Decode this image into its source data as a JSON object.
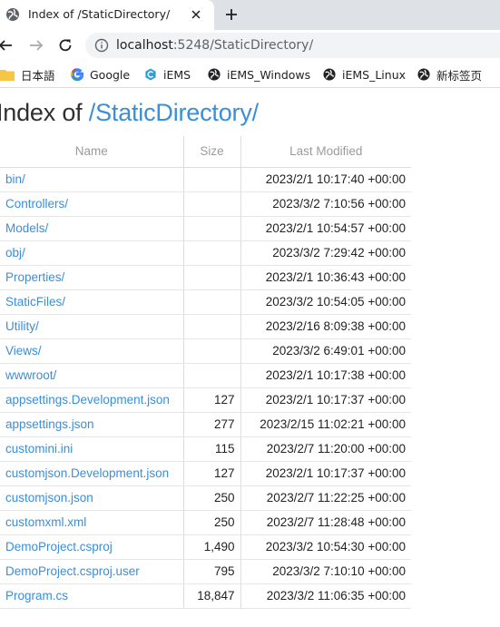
{
  "tab": {
    "title": "Index of /StaticDirectory/"
  },
  "address_bar": {
    "host": "localhost",
    "path": ":5248/StaticDirectory/"
  },
  "bookmarks": [
    {
      "label": "日本語",
      "icon": "folder-icon"
    },
    {
      "label": "Google",
      "icon": "google-icon"
    },
    {
      "label": "iEMS",
      "icon": "iems-icon"
    },
    {
      "label": "iEMS_Windows",
      "icon": "globe-icon"
    },
    {
      "label": "iEMS_Linux",
      "icon": "globe-icon"
    },
    {
      "label": "新标签页",
      "icon": "globe-icon"
    }
  ],
  "heading": {
    "prefix": "Index of ",
    "directory": "/StaticDirectory/"
  },
  "table": {
    "headers": {
      "name": "Name",
      "size": "Size",
      "modified": "Last Modified"
    },
    "rows": [
      {
        "name": "bin/",
        "size": "",
        "modified": "2023/2/1 10:17:40 +00:00"
      },
      {
        "name": "Controllers/",
        "size": "",
        "modified": "2023/3/2 7:10:56 +00:00"
      },
      {
        "name": "Models/",
        "size": "",
        "modified": "2023/2/1 10:54:57 +00:00"
      },
      {
        "name": "obj/",
        "size": "",
        "modified": "2023/3/2 7:29:42 +00:00"
      },
      {
        "name": "Properties/",
        "size": "",
        "modified": "2023/2/1 10:36:43 +00:00"
      },
      {
        "name": "StaticFiles/",
        "size": "",
        "modified": "2023/3/2 10:54:05 +00:00"
      },
      {
        "name": "Utility/",
        "size": "",
        "modified": "2023/2/16 8:09:38 +00:00"
      },
      {
        "name": "Views/",
        "size": "",
        "modified": "2023/3/2 6:49:01 +00:00"
      },
      {
        "name": "wwwroot/",
        "size": "",
        "modified": "2023/2/1 10:17:38 +00:00"
      },
      {
        "name": "appsettings.Development.json",
        "size": "127",
        "modified": "2023/2/1 10:17:37 +00:00"
      },
      {
        "name": "appsettings.json",
        "size": "277",
        "modified": "2023/2/15 11:02:21 +00:00"
      },
      {
        "name": "customini.ini",
        "size": "115",
        "modified": "2023/2/7 11:20:00 +00:00"
      },
      {
        "name": "customjson.Development.json",
        "size": "127",
        "modified": "2023/2/1 10:17:37 +00:00"
      },
      {
        "name": "customjson.json",
        "size": "250",
        "modified": "2023/2/7 11:22:25 +00:00"
      },
      {
        "name": "customxml.xml",
        "size": "250",
        "modified": "2023/2/7 11:28:48 +00:00"
      },
      {
        "name": "DemoProject.csproj",
        "size": "1,490",
        "modified": "2023/3/2 10:54:30 +00:00"
      },
      {
        "name": "DemoProject.csproj.user",
        "size": "795",
        "modified": "2023/3/2 7:10:10 +00:00"
      },
      {
        "name": "Program.cs",
        "size": "18,847",
        "modified": "2023/3/2 11:06:35 +00:00"
      }
    ]
  },
  "colors": {
    "link": "#3b8ed8",
    "tabstrip": "#dee1e6",
    "omnibox": "#f1f3f4"
  }
}
